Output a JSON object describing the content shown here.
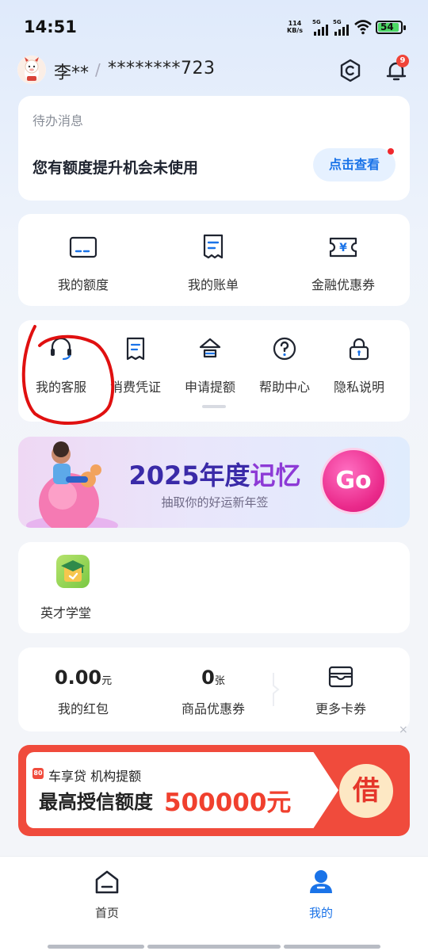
{
  "status_bar": {
    "time": "14:51",
    "net_speed_value": "114",
    "net_speed_unit": "KB/s",
    "sim1": "5G",
    "sim2": "5G",
    "battery": "54"
  },
  "user": {
    "name": "李**",
    "account": "********723",
    "notification_count": "9"
  },
  "todo": {
    "title": "待办消息",
    "message": "您有额度提升机会未使用",
    "action": "点击查看"
  },
  "quick_links": [
    {
      "label": "我的额度",
      "icon": "card-icon"
    },
    {
      "label": "我的账单",
      "icon": "bill-icon"
    },
    {
      "label": "金融优惠券",
      "icon": "yen-ticket-icon"
    }
  ],
  "services": [
    {
      "label": "我的客服",
      "icon": "headset-icon"
    },
    {
      "label": "消费凭证",
      "icon": "receipt-icon"
    },
    {
      "label": "申请提额",
      "icon": "raise-limit-icon"
    },
    {
      "label": "帮助中心",
      "icon": "help-icon"
    },
    {
      "label": "隐私说明",
      "icon": "lock-icon"
    }
  ],
  "banner": {
    "title_year": "2025",
    "title_a": "年度",
    "title_b": "记忆",
    "subtitle": "抽取你的好运新年签",
    "go": "Go"
  },
  "academy": {
    "label": "英才学堂"
  },
  "wallet": [
    {
      "value": "0.00",
      "unit": "元",
      "label": "我的红包"
    },
    {
      "value": "0",
      "unit": "张",
      "label": "商品优惠券"
    },
    {
      "label": "更多卡券"
    }
  ],
  "ad": {
    "logo": "80",
    "brand": "车享贷 机构提额",
    "headline": "最高授信额度",
    "amount": "500000元",
    "cta": "借",
    "close": "×"
  },
  "tabbar": [
    {
      "label": "首页",
      "active": false
    },
    {
      "label": "我的",
      "active": true
    }
  ],
  "colors": {
    "accent": "#1a73e8",
    "ad_red": "#f04b3c",
    "banner_pink": "#ea2a8b",
    "annotation_red": "#e01010"
  }
}
